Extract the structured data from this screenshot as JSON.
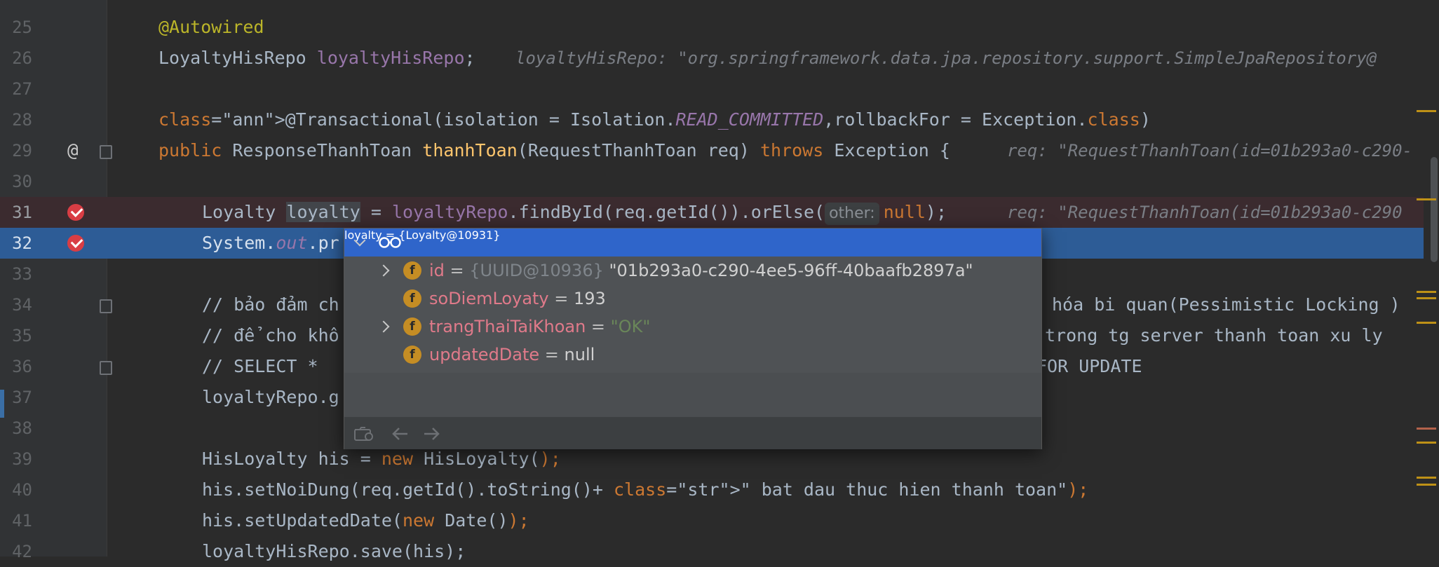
{
  "editor": {
    "lines": [
      {
        "n": "25",
        "code": "@Autowired"
      },
      {
        "n": "26",
        "code": "LoyaltyHisRepo loyaltyHisRepo;",
        "hint": "loyaltyHisRepo: \"org.springframework.data.jpa.repository.support.SimpleJpaRepository@"
      },
      {
        "n": "27",
        "code": ""
      },
      {
        "n": "28",
        "code": "@Transactional(isolation = Isolation.READ_COMMITTED,rollbackFor = Exception.class)"
      },
      {
        "n": "29",
        "code": "public ResponseThanhToan thanhToan(RequestThanhToan req) throws Exception {",
        "hint": "req: \"RequestThanhToan(id=01b293a0-c290-"
      },
      {
        "n": "30",
        "code": ""
      },
      {
        "n": "31",
        "code": "Loyalty loyalty = loyaltyRepo.findById(req.getId()).orElse( null);",
        "param_hint": "other:",
        "hint": "req: \"RequestThanhToan(id=01b293a0-c290"
      },
      {
        "n": "32",
        "code": "System.out.pr"
      },
      {
        "n": "33",
        "code": ""
      },
      {
        "n": "34",
        "code": "// bảo đảm ch",
        "tail": "hóa bi quan(Pessimistic Locking )"
      },
      {
        "n": "35",
        "code": "// để cho khô",
        "tail": "trong tg server thanh toan xu ly"
      },
      {
        "n": "36",
        "code": "// SELECT *",
        "tail": "FOR UPDATE"
      },
      {
        "n": "37",
        "code": "loyaltyRepo.g"
      },
      {
        "n": "38",
        "code": ""
      },
      {
        "n": "39",
        "code": "HisLoyalty his = new HisLoyalty();"
      },
      {
        "n": "40",
        "code": "his.setNoiDung(req.getId().toString()+ \" bat dau thuc hien thanh toan\");"
      },
      {
        "n": "41",
        "code": "his.setUpdatedDate(new Date());"
      },
      {
        "n": "42",
        "code": "loyaltyHisRepo.save(his);"
      }
    ]
  },
  "popup": {
    "header": {
      "name": "loyalty",
      "value": "{Loyalty@10931}"
    },
    "fields": [
      {
        "name": "id",
        "type": "{UUID@10936}",
        "value": "\"01b293a0-c290-4ee5-96ff-40baafb2897a\"",
        "expandable": true
      },
      {
        "name": "soDiemLoyaty",
        "value": "193",
        "expandable": false
      },
      {
        "name": "trangThaiTaiKhoan",
        "value": "\"OK\"",
        "expandable": true
      },
      {
        "name": "updatedDate",
        "value": "null",
        "expandable": false
      }
    ],
    "badge_letter": "f",
    "footer_icons": [
      "history-icon",
      "back-arrow-icon",
      "forward-arrow-icon"
    ]
  },
  "colors": {
    "keyword": "#cc7832",
    "annotation": "#bbb529",
    "field": "#9876aa",
    "method": "#ffc66d",
    "string": "#6a8759",
    "exec_line": "#2d5c96",
    "breakpoint": "#d93d44",
    "popup_header": "#2f65ca"
  }
}
